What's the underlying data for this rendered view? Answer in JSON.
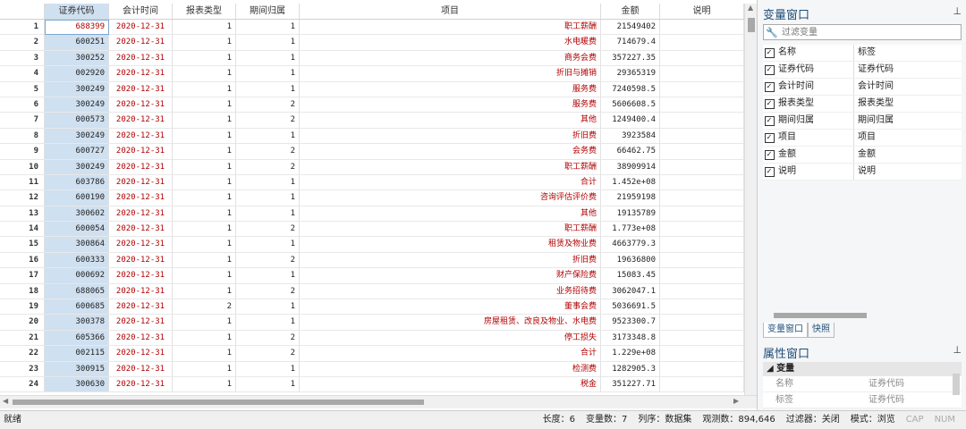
{
  "columns": [
    "证券代码",
    "会计时间",
    "报表类型",
    "期间归属",
    "项目",
    "金额",
    "说明"
  ],
  "rows": [
    {
      "idx": "1",
      "code": "688399",
      "date": "2020-12-31",
      "type": "1",
      "period": "1",
      "item": "职工薪酬",
      "amount": "21549402"
    },
    {
      "idx": "2",
      "code": "600251",
      "date": "2020-12-31",
      "type": "1",
      "period": "1",
      "item": "水电暖费",
      "amount": "714679.4"
    },
    {
      "idx": "3",
      "code": "300252",
      "date": "2020-12-31",
      "type": "1",
      "period": "1",
      "item": "商务会费",
      "amount": "357227.35"
    },
    {
      "idx": "4",
      "code": "002920",
      "date": "2020-12-31",
      "type": "1",
      "period": "1",
      "item": "折旧与摊销",
      "amount": "29365319"
    },
    {
      "idx": "5",
      "code": "300249",
      "date": "2020-12-31",
      "type": "1",
      "period": "1",
      "item": "服务费",
      "amount": "7240598.5"
    },
    {
      "idx": "6",
      "code": "300249",
      "date": "2020-12-31",
      "type": "1",
      "period": "2",
      "item": "服务费",
      "amount": "5606608.5"
    },
    {
      "idx": "7",
      "code": "000573",
      "date": "2020-12-31",
      "type": "1",
      "period": "2",
      "item": "其他",
      "amount": "1249400.4"
    },
    {
      "idx": "8",
      "code": "300249",
      "date": "2020-12-31",
      "type": "1",
      "period": "1",
      "item": "折旧费",
      "amount": "3923584"
    },
    {
      "idx": "9",
      "code": "600727",
      "date": "2020-12-31",
      "type": "1",
      "period": "2",
      "item": "会务费",
      "amount": "66462.75"
    },
    {
      "idx": "10",
      "code": "300249",
      "date": "2020-12-31",
      "type": "1",
      "period": "2",
      "item": "职工薪酬",
      "amount": "38909914"
    },
    {
      "idx": "11",
      "code": "603786",
      "date": "2020-12-31",
      "type": "1",
      "period": "1",
      "item": "合计",
      "amount": "1.452e+08"
    },
    {
      "idx": "12",
      "code": "600190",
      "date": "2020-12-31",
      "type": "1",
      "period": "1",
      "item": "咨询评估评价费",
      "amount": "21959198"
    },
    {
      "idx": "13",
      "code": "300602",
      "date": "2020-12-31",
      "type": "1",
      "period": "1",
      "item": "其他",
      "amount": "19135789"
    },
    {
      "idx": "14",
      "code": "600054",
      "date": "2020-12-31",
      "type": "1",
      "period": "2",
      "item": "职工薪酬",
      "amount": "1.773e+08"
    },
    {
      "idx": "15",
      "code": "300864",
      "date": "2020-12-31",
      "type": "1",
      "period": "1",
      "item": "租赁及物业费",
      "amount": "4663779.3"
    },
    {
      "idx": "16",
      "code": "600333",
      "date": "2020-12-31",
      "type": "1",
      "period": "2",
      "item": "折旧费",
      "amount": "19636800"
    },
    {
      "idx": "17",
      "code": "000692",
      "date": "2020-12-31",
      "type": "1",
      "period": "1",
      "item": "财产保险费",
      "amount": "15083.45"
    },
    {
      "idx": "18",
      "code": "688065",
      "date": "2020-12-31",
      "type": "1",
      "period": "2",
      "item": "业务招待费",
      "amount": "3062047.1"
    },
    {
      "idx": "19",
      "code": "600685",
      "date": "2020-12-31",
      "type": "2",
      "period": "1",
      "item": "董事会费",
      "amount": "5036691.5"
    },
    {
      "idx": "20",
      "code": "300378",
      "date": "2020-12-31",
      "type": "1",
      "period": "1",
      "item": "房屋租赁、改良及物业、水电费",
      "amount": "9523300.7"
    },
    {
      "idx": "21",
      "code": "605366",
      "date": "2020-12-31",
      "type": "1",
      "period": "2",
      "item": "停工损失",
      "amount": "3173348.8"
    },
    {
      "idx": "22",
      "code": "002115",
      "date": "2020-12-31",
      "type": "1",
      "period": "2",
      "item": "合计",
      "amount": "1.229e+08"
    },
    {
      "idx": "23",
      "code": "300915",
      "date": "2020-12-31",
      "type": "1",
      "period": "1",
      "item": "检测费",
      "amount": "1282905.3"
    },
    {
      "idx": "24",
      "code": "300630",
      "date": "2020-12-31",
      "type": "1",
      "period": "1",
      "item": "税金",
      "amount": "351227.71"
    }
  ],
  "var_window": {
    "title": "变量窗口",
    "filter_placeholder": "过滤变量",
    "header_name": "名称",
    "header_label": "标签",
    "vars": [
      {
        "name": "证券代码",
        "label": "证券代码"
      },
      {
        "name": "会计时间",
        "label": "会计时间"
      },
      {
        "name": "报表类型",
        "label": "报表类型"
      },
      {
        "name": "期间归属",
        "label": "期间归属"
      },
      {
        "name": "项目",
        "label": "项目"
      },
      {
        "name": "金额",
        "label": "金额"
      },
      {
        "name": "说明",
        "label": "说明"
      }
    ],
    "tabs": [
      "变量窗口",
      "快照"
    ]
  },
  "prop_window": {
    "title": "属性窗口",
    "section": "变量",
    "rows": [
      {
        "key": "名称",
        "value": "证券代码"
      },
      {
        "key": "标签",
        "value": "证券代码"
      }
    ]
  },
  "status": {
    "ready": "就绪",
    "length": "长度：6",
    "var_count": "变量数：7",
    "order": "列序：数据集",
    "obs": "观测数：894,646",
    "filter": "过滤器：关闭",
    "mode": "模式：浏览",
    "cap": "CAP",
    "num": "NUM"
  },
  "icons": {
    "pin": "pin-icon",
    "wrench": "wrench-icon",
    "check": "check-icon"
  }
}
